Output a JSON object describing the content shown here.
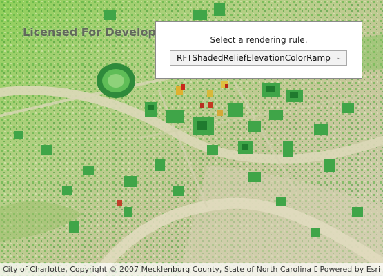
{
  "map": {
    "watermark": "Licensed For Develop",
    "attribution": "City of Charlotte, Copyright © 2007 Mecklenburg County, State of North Carolina D...",
    "powered_by": "Powered by Esri"
  },
  "panel": {
    "label": "Select a rendering rule.",
    "selected_rule": "RFTShadedReliefElevationColorRamp"
  },
  "icons": {
    "dropdown": "chevron-down-icon"
  }
}
